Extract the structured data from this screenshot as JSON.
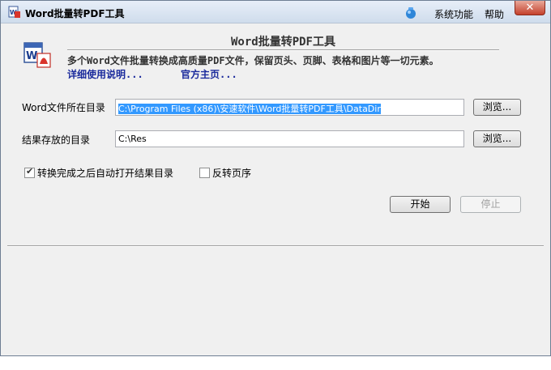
{
  "window": {
    "title": "Word批量转PDF工具"
  },
  "menu": {
    "system": "系统功能",
    "help": "帮助",
    "close": "✕"
  },
  "header": {
    "title": "Word批量转PDF工具",
    "description": "多个Word文件批量转换成高质量PDF文件，保留页头、页脚、表格和图片等一切元素。",
    "link_usage": "详细使用说明...",
    "link_home": "官方主页..."
  },
  "form": {
    "source_label": "Word文件所在目录",
    "source_value": "C:\\Program Files (x86)\\安速软件\\Word批量转PDF工具\\DataDir",
    "result_label": "结果存放的目录",
    "result_value": "C:\\Res",
    "browse_label": "浏览...",
    "auto_open_label": "转换完成之后自动打开结果目录",
    "auto_open_checked": true,
    "reverse_label": "反转页序",
    "reverse_checked": false,
    "start_label": "开始",
    "stop_label": "停止"
  }
}
